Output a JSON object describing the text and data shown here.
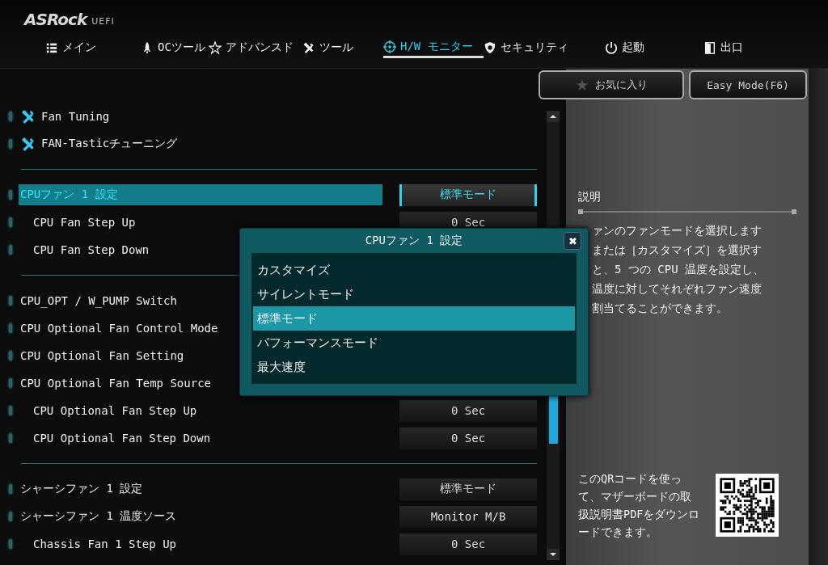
{
  "header": {
    "logo": "ASRock",
    "logo_suffix": "UEFI"
  },
  "tabs": [
    {
      "label": "メイン",
      "selected": false
    },
    {
      "label": "OCツール",
      "selected": false
    },
    {
      "label": "アドバンスド",
      "selected": false
    },
    {
      "label": "ツール",
      "selected": false
    },
    {
      "label": "H/W モニター",
      "selected": true
    },
    {
      "label": "セキュリティ",
      "selected": false
    },
    {
      "label": "起動",
      "selected": false
    },
    {
      "label": "出口",
      "selected": false
    }
  ],
  "top_buttons": [
    {
      "label": "お気に入り"
    },
    {
      "label": "Easy Mode(F6)"
    }
  ],
  "sections": [
    [
      {
        "kind": "menu",
        "label": "Fan Tuning"
      },
      {
        "kind": "menu",
        "label": "FAN-Tasticチューニング"
      }
    ],
    [
      {
        "kind": "setting",
        "label": "CPUファン 1 設定",
        "value": "標準モード",
        "selected": true,
        "children": [
          {
            "kind": "setting",
            "label": "CPU Fan Step Up",
            "value": "0 Sec",
            "selected": false
          },
          {
            "kind": "setting",
            "label": "CPU Fan Step Down",
            "selected": false
          }
        ]
      }
    ],
    [
      {
        "kind": "setting",
        "label": "CPU_OPT / W_PUMP Switch",
        "selected": false
      },
      {
        "kind": "setting",
        "label": "CPU Optional Fan Control Mode",
        "selected": false
      },
      {
        "kind": "setting",
        "label": "CPU Optional Fan Setting",
        "selected": false
      },
      {
        "kind": "setting",
        "label": "CPU Optional Fan Temp Source",
        "selected": false,
        "children": [
          {
            "kind": "setting",
            "label": "CPU Optional Fan Step Up",
            "value": "0 Sec",
            "selected": false
          },
          {
            "kind": "setting",
            "label": "CPU Optional Fan Step Down",
            "value": "0 Sec",
            "selected": false
          }
        ]
      }
    ],
    [
      {
        "kind": "setting",
        "label": "シャーシファン 1 設定",
        "value": "標準モード",
        "selected": false
      },
      {
        "kind": "setting",
        "label": "シャーシファン 1 温度ソース",
        "value": "Monitor M/B",
        "selected": false,
        "children": [
          {
            "kind": "setting",
            "label": "Chassis Fan 1 Step Up",
            "value": "0 Sec",
            "selected": false
          }
        ]
      }
    ]
  ],
  "description": {
    "title": "説明",
    "lines": [
      "ァンのファンモードを選択します",
      "または［カスタマイズ］を選択す",
      "と、5 つの CPU 温度を設定し、",
      "温度に対してそれぞれファン速度",
      "割当てることができます。"
    ]
  },
  "qr_note": "このQRコードを使って、マザーボードの取扱説明書PDFをダウンロードできます。",
  "popup": {
    "title": "CPUファン 1 設定",
    "close": "✖",
    "options": [
      {
        "label": "カスタマイズ",
        "selected": false
      },
      {
        "label": "サイレントモード",
        "selected": false
      },
      {
        "label": "標準モード",
        "selected": true
      },
      {
        "label": "パフォーマンスモード",
        "selected": false
      },
      {
        "label": "最大速度",
        "selected": false
      }
    ]
  }
}
